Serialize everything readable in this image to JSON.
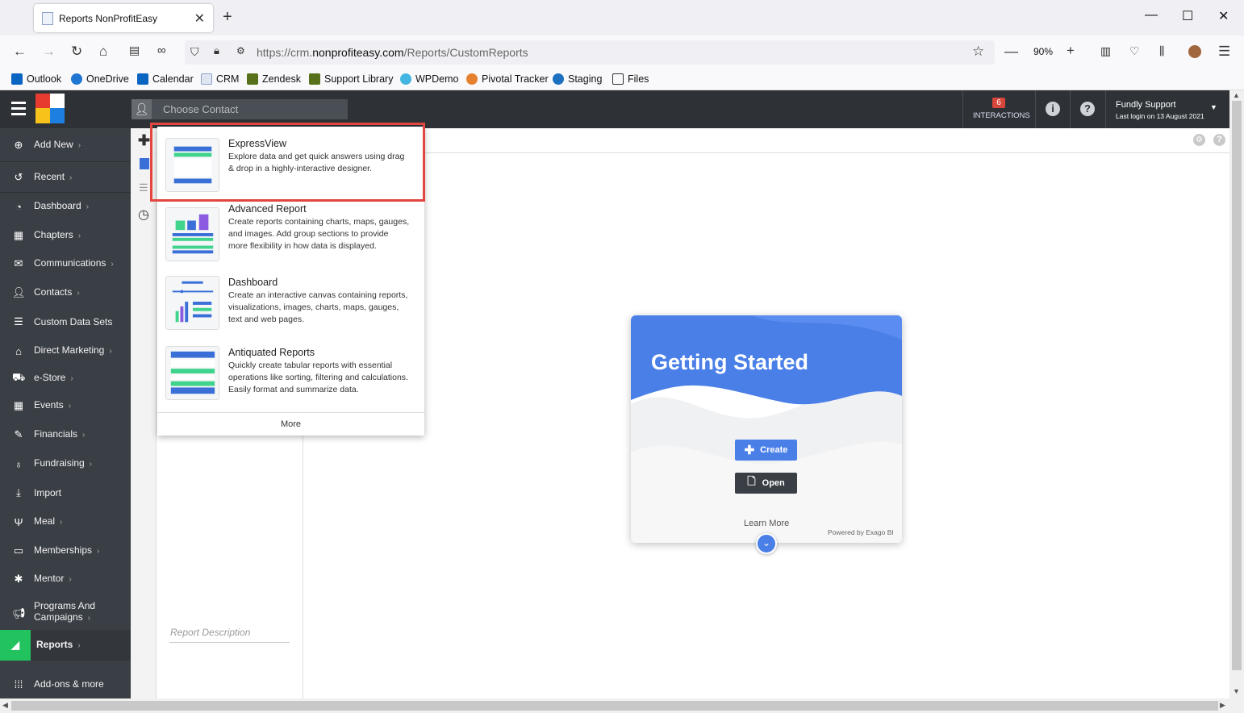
{
  "browser": {
    "tab_title": "Reports NonProfitEasy",
    "url_prefix": "https://crm.",
    "url_domain": "nonprofiteasy.com",
    "url_path": "/Reports/CustomReports",
    "zoom": "90%",
    "bookmarks": [
      "Outlook",
      "OneDrive",
      "Calendar",
      "CRM",
      "Zendesk",
      "Support Library",
      "WPDemo",
      "Pivotal Tracker",
      "Staging",
      "Files"
    ]
  },
  "header": {
    "contact_placeholder": "Choose Contact",
    "interactions_count": "6",
    "interactions_label": "INTERACTIONS",
    "user_name": "Fundly Support",
    "last_login": "Last login on 13 August 2021"
  },
  "sidebar": {
    "items": [
      {
        "label": "Add New",
        "icon": "plus-circle-icon"
      },
      {
        "label": "Recent",
        "icon": "history-icon"
      },
      {
        "label": "Dashboard",
        "icon": "dashboard-icon"
      },
      {
        "label": "Chapters",
        "icon": "grid-icon"
      },
      {
        "label": "Communications",
        "icon": "envelope-icon"
      },
      {
        "label": "Contacts",
        "icon": "user-icon"
      },
      {
        "label": "Custom Data Sets",
        "icon": "database-icon"
      },
      {
        "label": "Direct Marketing",
        "icon": "building-icon"
      },
      {
        "label": "e-Store",
        "icon": "cart-icon"
      },
      {
        "label": "Events",
        "icon": "calendar-icon"
      },
      {
        "label": "Financials",
        "icon": "money-icon"
      },
      {
        "label": "Fundraising",
        "icon": "moneybag-icon"
      },
      {
        "label": "Import",
        "icon": "import-icon"
      },
      {
        "label": "Meal",
        "icon": "utensils-icon"
      },
      {
        "label": "Memberships",
        "icon": "idcard-icon"
      },
      {
        "label": "Mentor",
        "icon": "mentor-icon"
      },
      {
        "label": "Programs And Campaigns",
        "icon": "megaphone-icon"
      },
      {
        "label": "Reports",
        "icon": "chart-area-icon"
      },
      {
        "label": "Add-ons & more",
        "icon": "apps-icon"
      }
    ]
  },
  "report_panel": {
    "description_placeholder": "Report Description"
  },
  "dropdown": {
    "items": [
      {
        "title": "ExpressView",
        "desc": "Explore data and get quick answers using drag & drop in a highly-interactive designer."
      },
      {
        "title": "Advanced Report",
        "desc": "Create reports containing charts, maps, gauges, and images. Add group sections to provide more flexibility in how data is displayed."
      },
      {
        "title": "Dashboard",
        "desc": "Create an interactive canvas containing reports, visualizations, images, charts, maps, gauges, text and web pages."
      },
      {
        "title": "Antiquated Reports",
        "desc": "Quickly create tabular reports with essential operations like sorting, filtering and calculations. Easily format and summarize data."
      }
    ],
    "more": "More"
  },
  "getting_started": {
    "title": "Getting Started",
    "create": "Create",
    "open": "Open",
    "learn_more": "Learn More",
    "powered_by": "Powered by Exago BI"
  },
  "colors": {
    "accent_blue": "#4a7fe8",
    "green": "#22c35e",
    "highlight_red": "#e2463e",
    "sidebar_bg": "#3a3f45"
  }
}
